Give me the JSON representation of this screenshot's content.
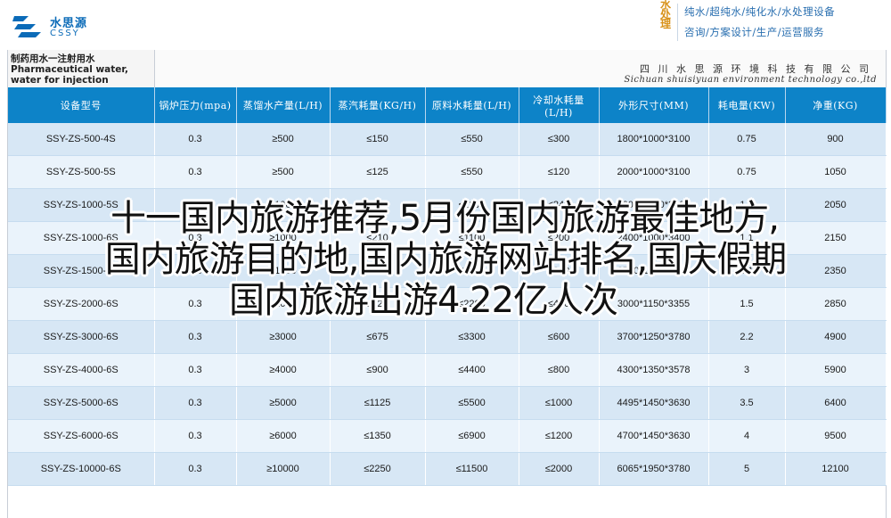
{
  "brand": {
    "name_cn": "水思源",
    "name_en": "CSSY"
  },
  "service": {
    "tag": "水处理",
    "line1": "纯水/超纯水/纯化水/水处理设备",
    "line2": "咨询/方案设计/生产/运营服务"
  },
  "sheet": {
    "title": "制药用水一注射用水 Pharmaceutical water, water for injection",
    "company_cn": "四 川 水 思 源 环 境 科 技 有 限 公 司",
    "company_en": "Sichuan shuisiyuan environment technology co.,ltd"
  },
  "table": {
    "headers": [
      "设备型号",
      "锅炉压力(mpa)",
      "蒸馏水产量(L/H)",
      "蒸汽耗量(KG/H)",
      "原料水耗量(L/H)",
      "冷却水耗量(L/H)",
      "外形尺寸(MM)",
      "耗电量(KW)",
      "净重(KG)"
    ],
    "rows": [
      [
        "SSY-ZS-500-4S",
        "0.3",
        "≥500",
        "≤150",
        "≤550",
        "≤300",
        "1800*1000*3100",
        "0.75",
        "900"
      ],
      [
        "SSY-ZS-500-5S",
        "0.3",
        "≥500",
        "≤125",
        "≤550",
        "≤120",
        "2000*1000*3100",
        "0.75",
        "1050"
      ],
      [
        "SSY-ZS-1000-5S",
        "0.3",
        "≥1000",
        "≤250",
        "≤1100",
        "≤240",
        "2200*1000*3380",
        "1.1",
        "2050"
      ],
      [
        "SSY-ZS-1000-6S",
        "0.3",
        "≥1000",
        "≤210",
        "≤1100",
        "≤200",
        "2400*1000*3400",
        "1.1",
        "2150"
      ],
      [
        "SSY-ZS-1500-6S",
        "0.3",
        "≥1500",
        "≤315",
        "≤1650",
        "≤300",
        "2700*1100*3400",
        "1.1",
        "2350"
      ],
      [
        "SSY-ZS-2000-6S",
        "0.3",
        "≥2000",
        "≤420",
        "≤2200",
        "≤400",
        "3000*1150*3355",
        "1.5",
        "2850"
      ],
      [
        "SSY-ZS-3000-6S",
        "0.3",
        "≥3000",
        "≤675",
        "≤3300",
        "≤600",
        "3700*1250*3780",
        "2.2",
        "4900"
      ],
      [
        "SSY-ZS-4000-6S",
        "0.3",
        "≥4000",
        "≤900",
        "≤4400",
        "≤800",
        "4300*1350*3578",
        "3",
        "5900"
      ],
      [
        "SSY-ZS-5000-6S",
        "0.3",
        "≥5000",
        "≤1125",
        "≤5500",
        "≤1000",
        "4495*1450*3630",
        "3.5",
        "6400"
      ],
      [
        "SSY-ZS-6000-6S",
        "0.3",
        "≥6000",
        "≤1350",
        "≤6900",
        "≤1200",
        "4700*1450*3630",
        "4",
        "9500"
      ],
      [
        "SSY-ZS-10000-6S",
        "0.3",
        "≥10000",
        "≤2250",
        "≤11500",
        "≤2000",
        "6065*1950*3780",
        "5",
        "12100"
      ]
    ]
  },
  "headline": {
    "line1": "十一国内旅游推荐,5月份国内旅游最佳地方,",
    "line2": "国内旅游目的地,国内旅游网站排名,国庆假期",
    "line3": "国内旅游出游4.22亿人次"
  },
  "colors": {
    "header_bg": "#0d83c8",
    "row_dark": "#d7e7f5",
    "row_light": "#eaf3fb",
    "brand_blue": "#0b6bb8",
    "accent_orange": "#d8921a"
  }
}
